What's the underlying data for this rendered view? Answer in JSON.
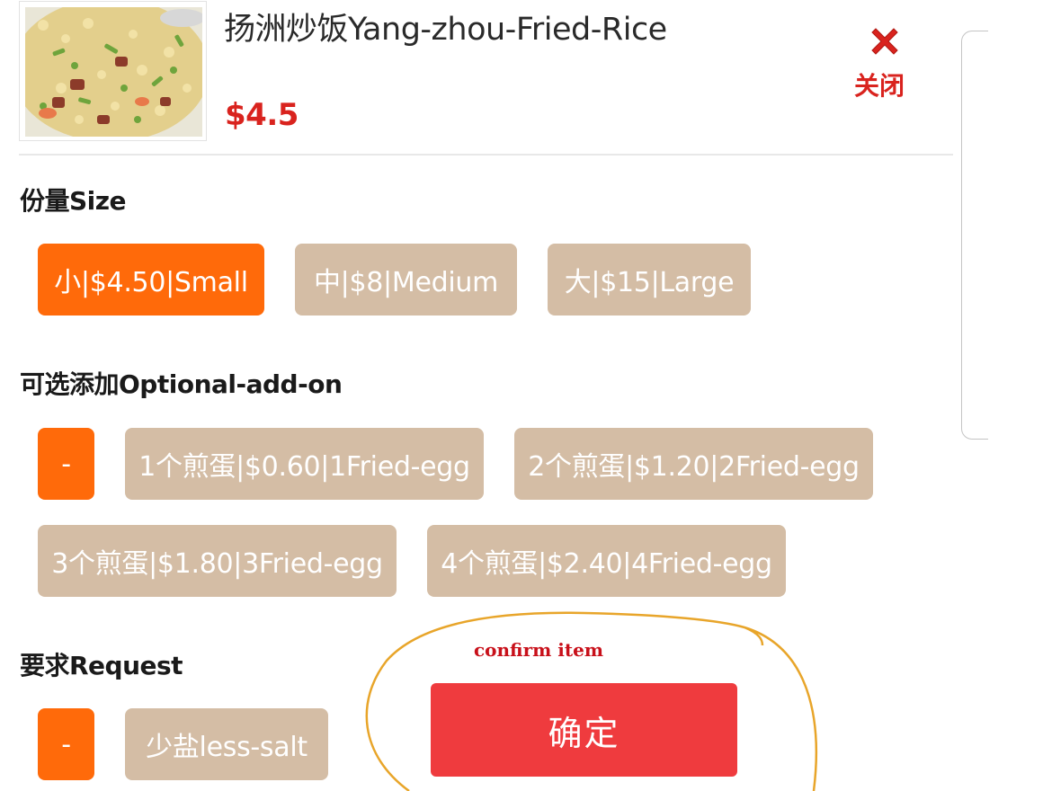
{
  "item": {
    "title": "扬洲炒饭Yang-zhou-Fried-Rice",
    "price": "$4.5",
    "image_icon": "fried-rice-photo"
  },
  "close": {
    "label": "关闭",
    "icon": "close-x-icon",
    "color": "#d9231e"
  },
  "size_section": {
    "title": "份量Size",
    "options": [
      {
        "label": "小|$4.50|Small",
        "selected": true
      },
      {
        "label": "中|$8|Medium",
        "selected": false
      },
      {
        "label": "大|$15|Large",
        "selected": false
      }
    ]
  },
  "addon_section": {
    "title": "可选添加Optional-add-on",
    "options": [
      {
        "label": "-",
        "selected": true
      },
      {
        "label": "1个煎蛋|$0.60|1Fried-egg",
        "selected": false
      },
      {
        "label": "2个煎蛋|$1.20|2Fried-egg",
        "selected": false
      },
      {
        "label": "3个煎蛋|$1.80|3Fried-egg",
        "selected": false
      },
      {
        "label": "4个煎蛋|$2.40|4Fried-egg",
        "selected": false
      }
    ]
  },
  "request_section": {
    "title": "要求Request",
    "options": [
      {
        "label": "-",
        "selected": true
      },
      {
        "label": "少盐less-salt",
        "selected": false
      }
    ]
  },
  "confirm": {
    "label": "确定",
    "annotation": "confirm item"
  },
  "colors": {
    "accent_orange": "#ff6a0a",
    "chip_tan": "#d4bda5",
    "confirm_red": "#ef3b3e",
    "price_red": "#d9231e",
    "annotation_stroke": "#e8a52a"
  }
}
